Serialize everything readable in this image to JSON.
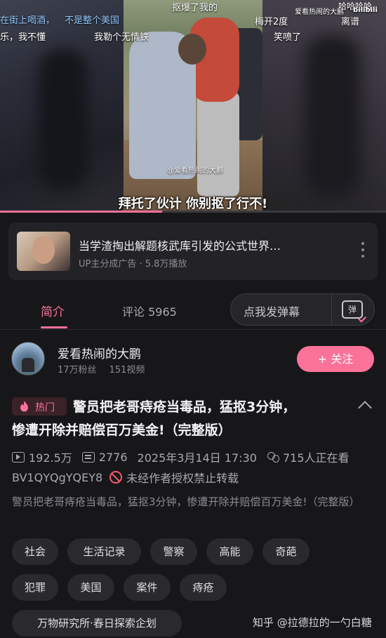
{
  "video": {
    "overlay_left_1": "在街上喝酒，",
    "overlay_left_2": "不是整个美国",
    "overlay_left_3": "乐，我不懂",
    "overlay_mid_1": "我勒个无情铁",
    "overlay_top": "抠爆了我的",
    "overlay_right_1": "梅开2度",
    "overlay_right_2": "笑喷了",
    "overlay_right_3": "爱看热闹的大鹏",
    "overlay_right_4": "哈哈哈哈",
    "overlay_right_5": "离谱",
    "brand": "bilibili",
    "watermark": "@爱看热闹的大鹏",
    "subtitle": "拜托了伙计 你别抠了行不!",
    "progress_fraction": 0.42
  },
  "ad": {
    "title": "当学渣掏出解题核武库引发的公式世界…",
    "meta": "UP主分成广告 · 5.8万播放"
  },
  "tabs": {
    "intro": "简介",
    "comments": "评论 5965",
    "danmaku_placeholder": "点我发弹幕",
    "danmaku_icon": "弹"
  },
  "uploader": {
    "name": "爱看热闹的大鹏",
    "fans": "17万粉丝",
    "videos": "151视频",
    "follow": "+ 关注"
  },
  "video_info": {
    "hot_badge": "热门",
    "title_line1": "警员把老哥痔疮当毒品，猛抠3分钟，",
    "title_line2": "惨遭开除并赔偿百万美金!（完整版）",
    "views": "192.5万",
    "danmaku_count": "2776",
    "date": "2025年3月14日 17:30",
    "watching": "715人正在看",
    "bvid": "BV1QYQgYQEY8",
    "no_repost": "未经作者授权禁止转载",
    "description": "警员把老哥痔疮当毒品，猛抠3分钟，惨遭开除并赔偿百万美金!（完整版）"
  },
  "tags": [
    "社会",
    "生活记录",
    "警察",
    "高能",
    "奇葩",
    "犯罪",
    "美国",
    "案件",
    "痔疮",
    "万物研究所·春日探索企划"
  ],
  "credit": "知乎 @拉德拉的一勺白糖",
  "colors": {
    "accent": "#fb7299",
    "background": "#17171a",
    "card": "#232327",
    "warning": "#f25d6b"
  }
}
